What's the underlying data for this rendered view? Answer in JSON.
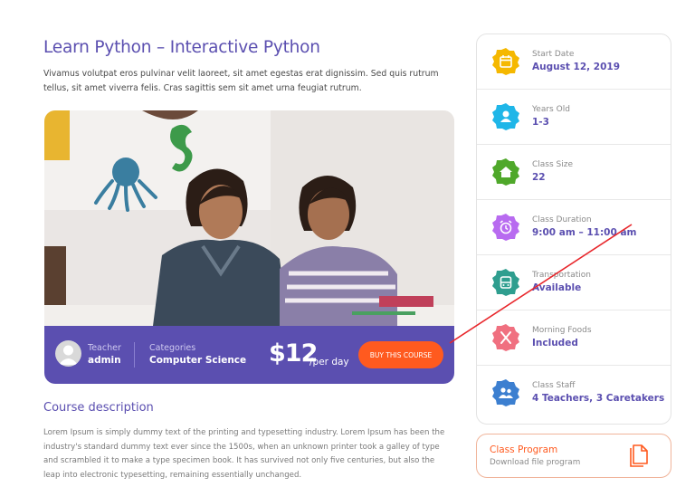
{
  "course": {
    "title": "Learn Python – Interactive Python",
    "intro": "Vivamus volutpat eros pulvinar velit laoreet, sit amet egestas erat dignissim. Sed quis rutrum tellus, sit amet viverra felis. Cras sagittis sem sit amet urna feugiat rutrum."
  },
  "info_bar": {
    "teacher_label": "Teacher",
    "teacher_name": "admin",
    "categories_label": "Categories",
    "category": "Computer Science",
    "price": "$12",
    "per_day": "/per day",
    "buy_label": "BUY THIS COURSE",
    "colors": {
      "bar": "#5b4fb0",
      "button": "#ff5a1f"
    }
  },
  "description": {
    "title": "Course description",
    "text": "Lorem Ipsum is simply dummy text of the printing and typesetting industry. Lorem Ipsum has been the industry's standard dummy text ever since the 1500s, when an unknown printer took a galley of type and scrambled it to make a type specimen book. It has survived not only five centuries, but also the leap into electronic typesetting, remaining essentially unchanged."
  },
  "details": [
    {
      "label": "Start Date",
      "value": "August 12, 2019",
      "color": "#f5b800",
      "icon": "calendar-icon"
    },
    {
      "label": "Years Old",
      "value": "1-3",
      "color": "#1fb6e8",
      "icon": "user-icon"
    },
    {
      "label": "Class Size",
      "value": "22",
      "color": "#4fa82a",
      "icon": "home-icon"
    },
    {
      "label": "Class Duration",
      "value": "9:00 am – 11:00 am",
      "color": "#b86bf0",
      "icon": "alarm-clock-icon"
    },
    {
      "label": "Transportation",
      "value": "Available",
      "color": "#2f9e8f",
      "icon": "bus-icon"
    },
    {
      "label": "Morning Foods",
      "value": "Included",
      "color": "#f07080",
      "icon": "utensils-icon"
    },
    {
      "label": "Class Staff",
      "value": "4 Teachers, 3 Caretakers",
      "color": "#3c7fd0",
      "icon": "staff-icon"
    }
  ],
  "program": {
    "title": "Class Program",
    "subtitle": "Download file program",
    "icon": "document-icon"
  }
}
